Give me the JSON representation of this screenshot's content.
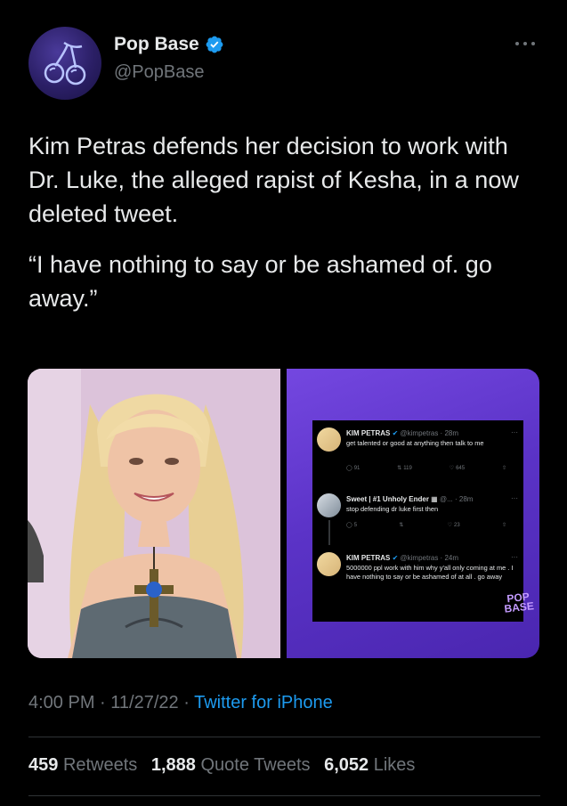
{
  "author": {
    "display_name": "Pop Base",
    "handle": "@PopBase",
    "verified": true,
    "avatar_icon": "cherry-icon",
    "verified_color": "#1d9bf0"
  },
  "tweet": {
    "paragraphs": [
      "Kim Petras defends her decision to work with Dr. Luke, the alleged rapist of Kesha, in a now deleted tweet.",
      "“I have nothing to say or be ashamed of. go away.”"
    ]
  },
  "embedded_screenshot": {
    "tweets": [
      {
        "name": "KIM PETRAS",
        "handle": "@kimpetras",
        "time": "28m",
        "text": "get talented or good at anything then talk to me",
        "replies": "91",
        "retweets": "119",
        "likes": "645"
      },
      {
        "name": "Sweet | #1 Unholy Ender",
        "handle": "@...",
        "time": "28m",
        "text": "stop defending dr luke first then",
        "replies": "5",
        "retweets": "",
        "likes": "23"
      },
      {
        "name": "KIM PETRAS",
        "handle": "@kimpetras",
        "time": "24m",
        "text": "5000000 ppl work with him why y'all only coming at me . I have nothing to say or be ashamed of at all . go away"
      }
    ],
    "watermark_line1": "POP",
    "watermark_line2": "BASE"
  },
  "meta": {
    "time": "4:00 PM",
    "date": "11/27/22",
    "separator": "·",
    "source": "Twitter for iPhone"
  },
  "stats": {
    "retweets_count": "459",
    "retweets_label": "Retweets",
    "quotes_count": "1,888",
    "quotes_label": "Quote Tweets",
    "likes_count": "6,052",
    "likes_label": "Likes"
  },
  "colors": {
    "background": "#000000",
    "text_primary": "#e7e9ea",
    "text_secondary": "#71767b",
    "link": "#1d9bf0",
    "divider": "#2f3336",
    "screenshot_bg": "#5b33c7"
  }
}
